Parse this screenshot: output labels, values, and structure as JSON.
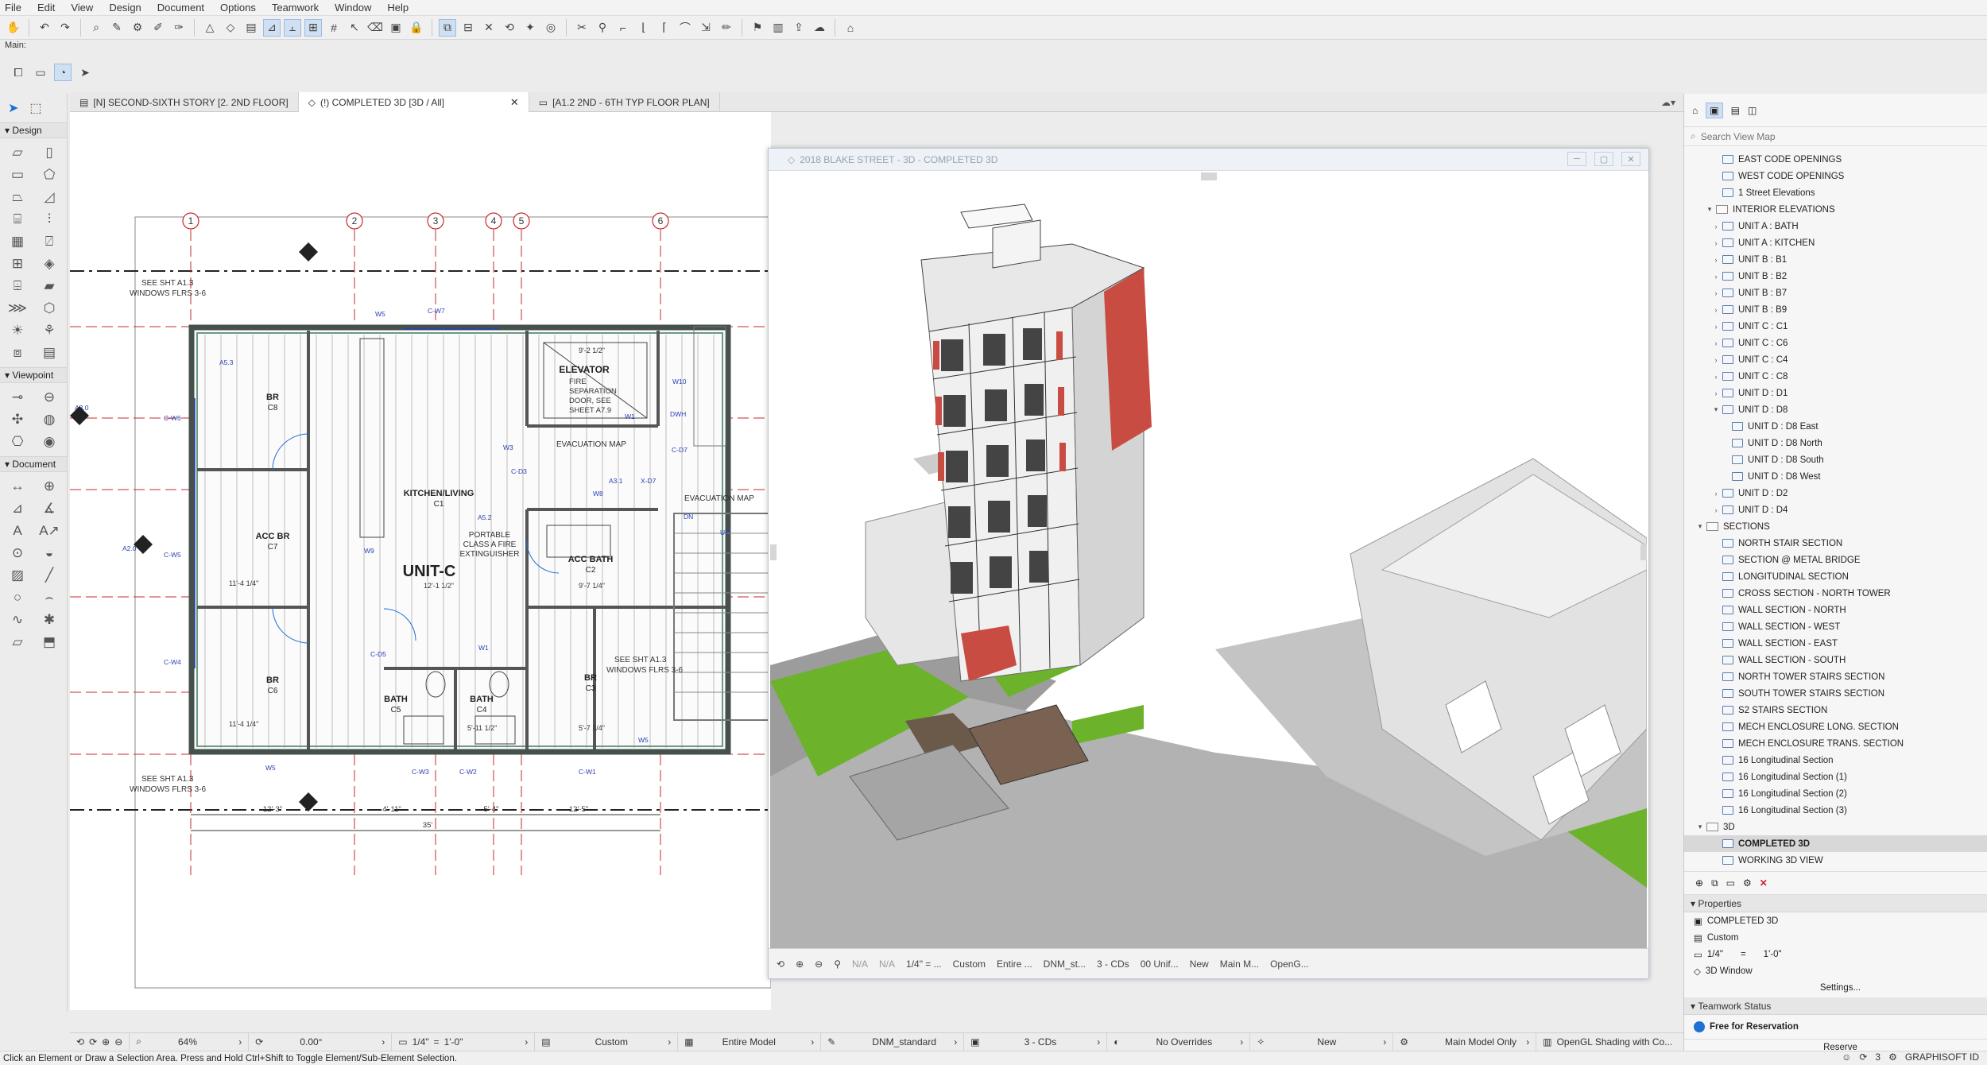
{
  "menu": [
    "File",
    "Edit",
    "View",
    "Design",
    "Document",
    "Options",
    "Teamwork",
    "Window",
    "Help"
  ],
  "toolbar": {
    "main_label": "Main:"
  },
  "toolbox": {
    "design": "Design",
    "viewpoint": "Viewpoint",
    "document": "Document"
  },
  "tabs": [
    "[N] SECOND-SIXTH STORY [2. 2ND FLOOR]",
    "(!) COMPLETED 3D [3D / All]",
    "[A1.2 2ND - 6TH TYP FLOOR PLAN]"
  ],
  "plan": {
    "grid": [
      "1",
      "2",
      "3",
      "4",
      "5",
      "6"
    ],
    "unit": "UNIT-C",
    "rooms": [
      {
        "name": "BR",
        "tag": "C8"
      },
      {
        "name": "ACC BR",
        "tag": "C7"
      },
      {
        "name": "BR",
        "tag": "C6"
      },
      {
        "name": "KITCHEN/LIVING",
        "tag": "C1"
      },
      {
        "name": "ACC BATH",
        "tag": "C2"
      },
      {
        "name": "BATH",
        "tag": "C5"
      },
      {
        "name": "BATH",
        "tag": "C4"
      },
      {
        "name": "BR",
        "tag": "C3"
      }
    ],
    "elevator": "ELEVATOR",
    "elevator_note": [
      "FIRE",
      "SEPARATION",
      "DOOR, SEE",
      "SHEET A7.9"
    ],
    "evac": "EVACUATION MAP",
    "extinguisher": [
      "PORTABLE",
      "CLASS A FIRE",
      "EXTINGUISHER"
    ],
    "note_sht": [
      "SEE SHT A1.3",
      "WINDOWS FLRS 3-6"
    ],
    "dims": {
      "top": "9'-2 1/2\"",
      "d1": "11'-4 1/4\"",
      "d2": "12'-1 1/2\"",
      "d3": "9'-7 1/4\"",
      "d4": "11'-4 1/4\"",
      "d5": "5'-11 1/2\"",
      "d6": "5'-7 1/4\"",
      "b1": "12'-3\"",
      "b2": "4'-11\"",
      "b3": "5'-4\"",
      "b4": "12'-5\"",
      "total": "35'"
    },
    "tags": [
      "W5",
      "C-W7",
      "W10",
      "W1",
      "DWH",
      "C-W6",
      "A5.3",
      "C-D7",
      "C-D3",
      "C-D5",
      "W8",
      "W3",
      "A5.2",
      "A3.1",
      "X-D7",
      "C-W5",
      "C-W4",
      "W9",
      "W1",
      "C-W3",
      "C-W2",
      "C-W1",
      "W5",
      "W5",
      "A2.0",
      "A3.0",
      "UP",
      "DN"
    ]
  },
  "win3d": {
    "title": "2018 BLAKE STREET - 3D - COMPLETED 3D",
    "status": [
      "N/A",
      "N/A",
      "1/4\" = ...",
      "Custom",
      "Entire ...",
      "DNM_st...",
      "3 - CDs",
      "00 Unif...",
      "New",
      "Main M...",
      "OpenG..."
    ]
  },
  "right": {
    "search": "Search View Map",
    "tree": [
      {
        "t": "EAST CODE OPENINGS",
        "lvl": 2,
        "k": "v"
      },
      {
        "t": "WEST CODE OPENINGS",
        "lvl": 2,
        "k": "v"
      },
      {
        "t": "1 Street Elevations",
        "lvl": 2,
        "k": "v"
      },
      {
        "t": "INTERIOR ELEVATIONS",
        "lvl": 1,
        "k": "f",
        "ar": "v"
      },
      {
        "t": "UNIT A : BATH",
        "lvl": 2,
        "k": "v",
        "ar": ">"
      },
      {
        "t": "UNIT A : KITCHEN",
        "lvl": 2,
        "k": "v",
        "ar": ">"
      },
      {
        "t": "UNIT B : B1",
        "lvl": 2,
        "k": "v",
        "ar": ">"
      },
      {
        "t": "UNIT B : B2",
        "lvl": 2,
        "k": "v",
        "ar": ">"
      },
      {
        "t": "UNIT B : B7",
        "lvl": 2,
        "k": "v",
        "ar": ">"
      },
      {
        "t": "UNIT B : B9",
        "lvl": 2,
        "k": "v",
        "ar": ">"
      },
      {
        "t": "UNIT C : C1",
        "lvl": 2,
        "k": "v",
        "ar": ">"
      },
      {
        "t": "UNIT C : C6",
        "lvl": 2,
        "k": "v",
        "ar": ">"
      },
      {
        "t": "UNIT C : C4",
        "lvl": 2,
        "k": "v",
        "ar": ">"
      },
      {
        "t": "UNIT C : C8",
        "lvl": 2,
        "k": "v",
        "ar": ">"
      },
      {
        "t": "UNIT D : D1",
        "lvl": 2,
        "k": "v",
        "ar": ">"
      },
      {
        "t": "UNIT D : D8",
        "lvl": 2,
        "k": "v",
        "ar": "v"
      },
      {
        "t": "UNIT D : D8 East",
        "lvl": 3,
        "k": "v"
      },
      {
        "t": "UNIT D : D8 North",
        "lvl": 3,
        "k": "v"
      },
      {
        "t": "UNIT D : D8 South",
        "lvl": 3,
        "k": "v"
      },
      {
        "t": "UNIT D : D8 West",
        "lvl": 3,
        "k": "v"
      },
      {
        "t": "UNIT D : D2",
        "lvl": 2,
        "k": "v",
        "ar": ">"
      },
      {
        "t": "UNIT D : D4",
        "lvl": 2,
        "k": "v",
        "ar": ">"
      },
      {
        "t": "SECTIONS",
        "lvl": 0,
        "k": "f",
        "ar": "v"
      },
      {
        "t": "NORTH STAIR SECTION",
        "lvl": 2,
        "k": "v"
      },
      {
        "t": "SECTION @ METAL BRIDGE",
        "lvl": 2,
        "k": "v"
      },
      {
        "t": "LONGITUDINAL SECTION",
        "lvl": 2,
        "k": "v"
      },
      {
        "t": "CROSS SECTION - NORTH TOWER",
        "lvl": 2,
        "k": "v"
      },
      {
        "t": "WALL SECTION - NORTH",
        "lvl": 2,
        "k": "v"
      },
      {
        "t": "WALL SECTION - WEST",
        "lvl": 2,
        "k": "v"
      },
      {
        "t": "WALL SECTION - EAST",
        "lvl": 2,
        "k": "v"
      },
      {
        "t": "WALL SECTION - SOUTH",
        "lvl": 2,
        "k": "v"
      },
      {
        "t": "NORTH TOWER STAIRS SECTION",
        "lvl": 2,
        "k": "v"
      },
      {
        "t": "SOUTH TOWER STAIRS SECTION",
        "lvl": 2,
        "k": "v"
      },
      {
        "t": "S2 STAIRS SECTION",
        "lvl": 2,
        "k": "v"
      },
      {
        "t": "MECH ENCLOSURE LONG. SECTION",
        "lvl": 2,
        "k": "v"
      },
      {
        "t": "MECH ENCLOSURE TRANS. SECTION",
        "lvl": 2,
        "k": "v"
      },
      {
        "t": "16 Longitudinal Section",
        "lvl": 2,
        "k": "v"
      },
      {
        "t": "16 Longitudinal Section (1)",
        "lvl": 2,
        "k": "v"
      },
      {
        "t": "16 Longitudinal Section (2)",
        "lvl": 2,
        "k": "v"
      },
      {
        "t": "16 Longitudinal Section (3)",
        "lvl": 2,
        "k": "v"
      },
      {
        "t": "3D",
        "lvl": 0,
        "k": "f",
        "ar": "v"
      },
      {
        "t": "COMPLETED 3D",
        "lvl": 2,
        "k": "v",
        "sel": true
      },
      {
        "t": "WORKING 3D VIEW",
        "lvl": 2,
        "k": "v"
      }
    ],
    "properties": {
      "head": "Properties",
      "name": "COMPLETED 3D",
      "scale_mode": "Custom",
      "scale_a": "1/4\"",
      "scale_eq": "=",
      "scale_b": "1'-0\"",
      "window": "3D Window",
      "settings": "Settings..."
    },
    "teamwork": {
      "head": "Teamwork Status",
      "status": "Free for Reservation",
      "reserve": "Reserve"
    }
  },
  "status": {
    "zoom": "64%",
    "angle": "0.00°",
    "scale_a": "1/4\"",
    "scale_eq": "=",
    "scale_b": "1'-0\"",
    "layer": "Custom",
    "model": "Entire Model",
    "pen": "DNM_standard",
    "layer_combo": "3 - CDs",
    "override": "No Overrides",
    "renovation": "New",
    "model_view": "Main Model Only",
    "shading": "OpenGL Shading with Co..."
  },
  "hint": "Click an Element or Draw a Selection Area. Press and Hold Ctrl+Shift to Toggle Element/Sub-Element Selection.",
  "footer": {
    "count": "3",
    "brand": "GRAPHISOFT ID"
  },
  "colors": {
    "accent": "#1a6fd6",
    "grid_red": "#c8282f",
    "tag_blue": "#2a3fb5",
    "grass": "#66b52a",
    "free_dot": "#1f6fd4"
  }
}
